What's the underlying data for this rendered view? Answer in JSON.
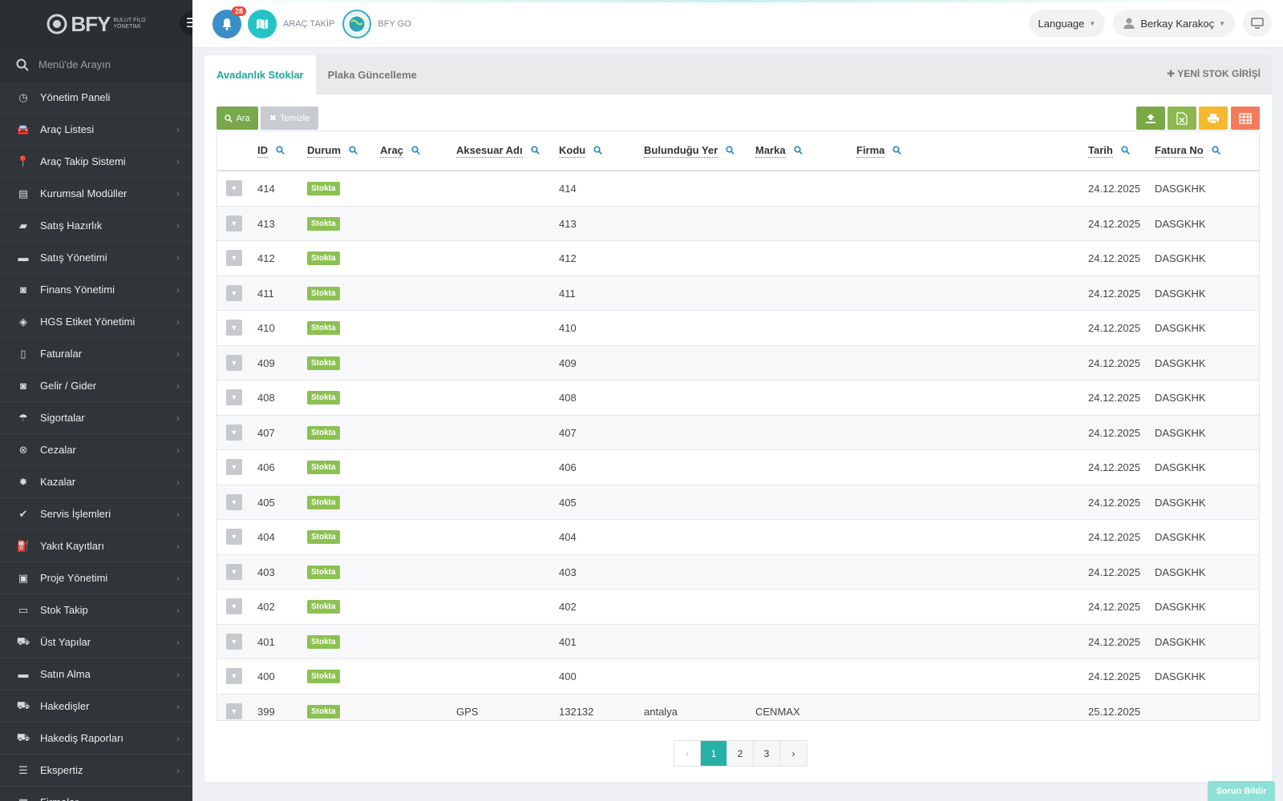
{
  "brand": {
    "logo_text": "BFY",
    "logo_sub_1": "BULUT FİLO",
    "logo_sub_2": "YÖNETİMİ"
  },
  "sidebar": {
    "search_placeholder": "Menü'de Arayın",
    "items": [
      {
        "label": "Yönetim Paneli",
        "icon": "dashboard-icon",
        "has_children": false
      },
      {
        "label": "Araç Listesi",
        "icon": "car-icon",
        "has_children": true
      },
      {
        "label": "Araç Takip Sistemi",
        "icon": "map-pin-icon",
        "has_children": true
      },
      {
        "label": "Kurumsal Modüller",
        "icon": "server-icon",
        "has_children": true
      },
      {
        "label": "Satış Hazırlık",
        "icon": "book-icon",
        "has_children": true
      },
      {
        "label": "Satış Yönetimi",
        "icon": "card-icon",
        "has_children": true
      },
      {
        "label": "Finans Yönetimi",
        "icon": "money-icon",
        "has_children": true
      },
      {
        "label": "HGS Etiket Yönetimi",
        "icon": "tag-icon",
        "has_children": true
      },
      {
        "label": "Faturalar",
        "icon": "file-icon",
        "has_children": true
      },
      {
        "label": "Gelir / Gider",
        "icon": "money-icon",
        "has_children": true
      },
      {
        "label": "Sigortalar",
        "icon": "umbrella-icon",
        "has_children": true
      },
      {
        "label": "Cezalar",
        "icon": "x-circle-icon",
        "has_children": true
      },
      {
        "label": "Kazalar",
        "icon": "crash-icon",
        "has_children": true
      },
      {
        "label": "Servis İşlemleri",
        "icon": "check-circle-icon",
        "has_children": true
      },
      {
        "label": "Yakıt Kayıtları",
        "icon": "fuel-icon",
        "has_children": true
      },
      {
        "label": "Proje Yönetimi",
        "icon": "briefcase-icon",
        "has_children": true
      },
      {
        "label": "Stok Takip",
        "icon": "inbox-icon",
        "has_children": true
      },
      {
        "label": "Üst Yapılar",
        "icon": "truck-icon",
        "has_children": true
      },
      {
        "label": "Satın Alma",
        "icon": "card-icon",
        "has_children": true
      },
      {
        "label": "Hakedişler",
        "icon": "truck-icon",
        "has_children": true
      },
      {
        "label": "Hakediş Raporları",
        "icon": "truck-icon",
        "has_children": true
      },
      {
        "label": "Ekspertiz",
        "icon": "list-icon",
        "has_children": true
      },
      {
        "label": "Firmalar",
        "icon": "building-icon",
        "has_children": true
      }
    ]
  },
  "topbar": {
    "notification_count": "28",
    "link_tracking": "ARAÇ TAKİP",
    "link_go": "BFY GO",
    "language": "Language",
    "user_name": "Berkay Karakoç"
  },
  "tabs": [
    {
      "label": "Avadanlık Stoklar",
      "active": true
    },
    {
      "label": "Plaka Güncelleme",
      "active": false
    }
  ],
  "new_stock_label": "YENİ STOK GİRİŞİ",
  "toolbar": {
    "search_label": "Ara",
    "clear_label": "Temizle"
  },
  "colors": {
    "teal": "#26b1a6",
    "green": "#78a84a",
    "excel": "#8cb84e",
    "print": "#f5b82e",
    "columns": "#f47b5b"
  },
  "table": {
    "columns": [
      "ID",
      "Durum",
      "Araç",
      "Aksesuar Adı",
      "Kodu",
      "Bulunduğu Yer",
      "Marka",
      "Firma",
      "Tarih",
      "Fatura No"
    ],
    "rows": [
      {
        "id": "414",
        "durum": "Stokta",
        "arac": "",
        "aksesuar": "",
        "kodu": "414",
        "yer": "",
        "marka": "",
        "firma": "",
        "tarih": "24.12.2025",
        "fatura": "DASGKHK"
      },
      {
        "id": "413",
        "durum": "Stokta",
        "arac": "",
        "aksesuar": "",
        "kodu": "413",
        "yer": "",
        "marka": "",
        "firma": "",
        "tarih": "24.12.2025",
        "fatura": "DASGKHK"
      },
      {
        "id": "412",
        "durum": "Stokta",
        "arac": "",
        "aksesuar": "",
        "kodu": "412",
        "yer": "",
        "marka": "",
        "firma": "",
        "tarih": "24.12.2025",
        "fatura": "DASGKHK"
      },
      {
        "id": "411",
        "durum": "Stokta",
        "arac": "",
        "aksesuar": "",
        "kodu": "411",
        "yer": "",
        "marka": "",
        "firma": "",
        "tarih": "24.12.2025",
        "fatura": "DASGKHK"
      },
      {
        "id": "410",
        "durum": "Stokta",
        "arac": "",
        "aksesuar": "",
        "kodu": "410",
        "yer": "",
        "marka": "",
        "firma": "",
        "tarih": "24.12.2025",
        "fatura": "DASGKHK"
      },
      {
        "id": "409",
        "durum": "Stokta",
        "arac": "",
        "aksesuar": "",
        "kodu": "409",
        "yer": "",
        "marka": "",
        "firma": "",
        "tarih": "24.12.2025",
        "fatura": "DASGKHK"
      },
      {
        "id": "408",
        "durum": "Stokta",
        "arac": "",
        "aksesuar": "",
        "kodu": "408",
        "yer": "",
        "marka": "",
        "firma": "",
        "tarih": "24.12.2025",
        "fatura": "DASGKHK"
      },
      {
        "id": "407",
        "durum": "Stokta",
        "arac": "",
        "aksesuar": "",
        "kodu": "407",
        "yer": "",
        "marka": "",
        "firma": "",
        "tarih": "24.12.2025",
        "fatura": "DASGKHK"
      },
      {
        "id": "406",
        "durum": "Stokta",
        "arac": "",
        "aksesuar": "",
        "kodu": "406",
        "yer": "",
        "marka": "",
        "firma": "",
        "tarih": "24.12.2025",
        "fatura": "DASGKHK"
      },
      {
        "id": "405",
        "durum": "Stokta",
        "arac": "",
        "aksesuar": "",
        "kodu": "405",
        "yer": "",
        "marka": "",
        "firma": "",
        "tarih": "24.12.2025",
        "fatura": "DASGKHK"
      },
      {
        "id": "404",
        "durum": "Stokta",
        "arac": "",
        "aksesuar": "",
        "kodu": "404",
        "yer": "",
        "marka": "",
        "firma": "",
        "tarih": "24.12.2025",
        "fatura": "DASGKHK"
      },
      {
        "id": "403",
        "durum": "Stokta",
        "arac": "",
        "aksesuar": "",
        "kodu": "403",
        "yer": "",
        "marka": "",
        "firma": "",
        "tarih": "24.12.2025",
        "fatura": "DASGKHK"
      },
      {
        "id": "402",
        "durum": "Stokta",
        "arac": "",
        "aksesuar": "",
        "kodu": "402",
        "yer": "",
        "marka": "",
        "firma": "",
        "tarih": "24.12.2025",
        "fatura": "DASGKHK"
      },
      {
        "id": "401",
        "durum": "Stokta",
        "arac": "",
        "aksesuar": "",
        "kodu": "401",
        "yer": "",
        "marka": "",
        "firma": "",
        "tarih": "24.12.2025",
        "fatura": "DASGKHK"
      },
      {
        "id": "400",
        "durum": "Stokta",
        "arac": "",
        "aksesuar": "",
        "kodu": "400",
        "yer": "",
        "marka": "",
        "firma": "",
        "tarih": "24.12.2025",
        "fatura": "DASGKHK"
      },
      {
        "id": "399",
        "durum": "Stokta",
        "arac": "",
        "aksesuar": "GPS",
        "kodu": "132132",
        "yer": "antalya",
        "marka": "CENMAX",
        "firma": "",
        "tarih": "25.12.2025",
        "fatura": ""
      }
    ]
  },
  "pagination": {
    "prev": "‹",
    "pages": [
      "1",
      "2",
      "3"
    ],
    "current": "1",
    "next": "›"
  },
  "report_issue": "Sorun Bildir"
}
